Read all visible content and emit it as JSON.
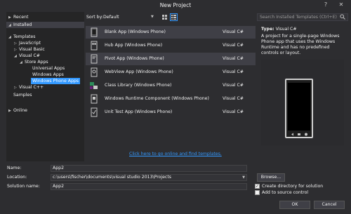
{
  "window": {
    "title": "New Project",
    "help": "?",
    "close": "✕"
  },
  "tree": {
    "recent": "Recent",
    "installed": "Installed",
    "templates": "Templates",
    "javascript": "JavaScript",
    "visual_basic": "Visual Basic",
    "visual_csharp": "Visual C#",
    "store_apps": "Store Apps",
    "universal_apps": "Universal Apps",
    "windows_apps": "Windows Apps",
    "windows_phone_apps": "Windows Phone Apps",
    "visual_cpp": "Visual C++",
    "samples": "Samples",
    "online": "Online"
  },
  "sort": {
    "label": "Sort by:",
    "value": "Default"
  },
  "templates": [
    {
      "name": "Blank App (Windows Phone)",
      "lang": "Visual C#"
    },
    {
      "name": "Hub App (Windows Phone)",
      "lang": "Visual C#"
    },
    {
      "name": "Pivot App (Windows Phone)",
      "lang": "Visual C#"
    },
    {
      "name": "WebView App (Windows Phone)",
      "lang": "Visual C#"
    },
    {
      "name": "Class Library (Windows Phone)",
      "lang": "Visual C#"
    },
    {
      "name": "Windows Runtime Component (Windows Phone)",
      "lang": "Visual C#"
    },
    {
      "name": "Unit Test App (Windows Phone)",
      "lang": "Visual C#"
    }
  ],
  "online_link": "Click here to go online and find templates.",
  "search": {
    "placeholder": "Search Installed Templates (Ctrl+E)"
  },
  "details": {
    "type_label": "Type:",
    "type_value": "Visual C#",
    "description": "A project for a single-page Windows Phone app that uses the Windows Runtime and has no predefined controls or layout."
  },
  "form": {
    "name_label": "Name:",
    "name_value": "App2",
    "location_label": "Location:",
    "location_value": "c:\\users\\fischer\\documents\\visual studio 2013\\Projects",
    "solution_label": "Solution name:",
    "solution_value": "App2",
    "browse": "Browse...",
    "create_dir": "Create directory for solution",
    "add_source": "Add to source control",
    "ok": "OK",
    "cancel": "Cancel"
  }
}
